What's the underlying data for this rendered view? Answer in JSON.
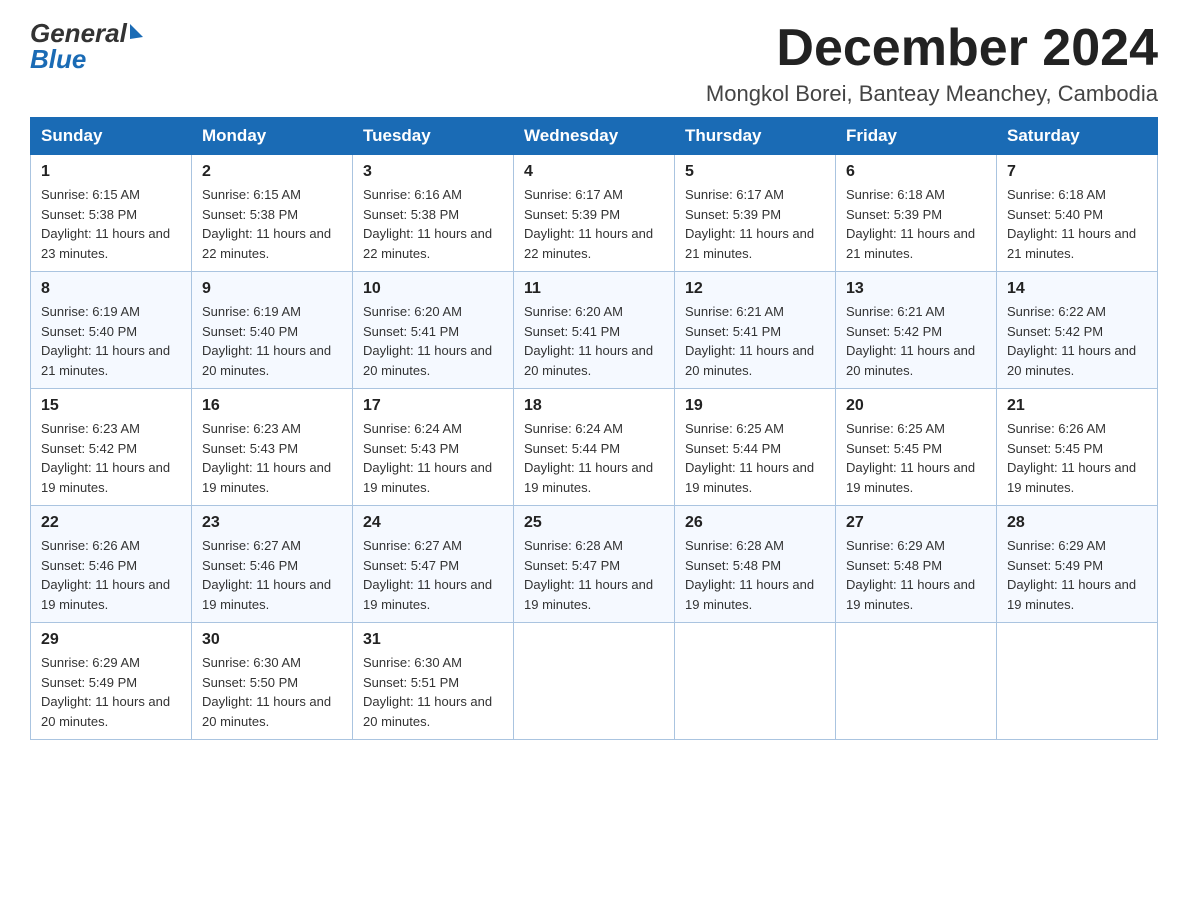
{
  "header": {
    "month_title": "December 2024",
    "location": "Mongkol Borei, Banteay Meanchey, Cambodia",
    "logo_general": "General",
    "logo_blue": "Blue"
  },
  "days_of_week": [
    "Sunday",
    "Monday",
    "Tuesday",
    "Wednesday",
    "Thursday",
    "Friday",
    "Saturday"
  ],
  "weeks": [
    [
      {
        "day": "1",
        "sunrise": "6:15 AM",
        "sunset": "5:38 PM",
        "daylight": "11 hours and 23 minutes."
      },
      {
        "day": "2",
        "sunrise": "6:15 AM",
        "sunset": "5:38 PM",
        "daylight": "11 hours and 22 minutes."
      },
      {
        "day": "3",
        "sunrise": "6:16 AM",
        "sunset": "5:38 PM",
        "daylight": "11 hours and 22 minutes."
      },
      {
        "day": "4",
        "sunrise": "6:17 AM",
        "sunset": "5:39 PM",
        "daylight": "11 hours and 22 minutes."
      },
      {
        "day": "5",
        "sunrise": "6:17 AM",
        "sunset": "5:39 PM",
        "daylight": "11 hours and 21 minutes."
      },
      {
        "day": "6",
        "sunrise": "6:18 AM",
        "sunset": "5:39 PM",
        "daylight": "11 hours and 21 minutes."
      },
      {
        "day": "7",
        "sunrise": "6:18 AM",
        "sunset": "5:40 PM",
        "daylight": "11 hours and 21 minutes."
      }
    ],
    [
      {
        "day": "8",
        "sunrise": "6:19 AM",
        "sunset": "5:40 PM",
        "daylight": "11 hours and 21 minutes."
      },
      {
        "day": "9",
        "sunrise": "6:19 AM",
        "sunset": "5:40 PM",
        "daylight": "11 hours and 20 minutes."
      },
      {
        "day": "10",
        "sunrise": "6:20 AM",
        "sunset": "5:41 PM",
        "daylight": "11 hours and 20 minutes."
      },
      {
        "day": "11",
        "sunrise": "6:20 AM",
        "sunset": "5:41 PM",
        "daylight": "11 hours and 20 minutes."
      },
      {
        "day": "12",
        "sunrise": "6:21 AM",
        "sunset": "5:41 PM",
        "daylight": "11 hours and 20 minutes."
      },
      {
        "day": "13",
        "sunrise": "6:21 AM",
        "sunset": "5:42 PM",
        "daylight": "11 hours and 20 minutes."
      },
      {
        "day": "14",
        "sunrise": "6:22 AM",
        "sunset": "5:42 PM",
        "daylight": "11 hours and 20 minutes."
      }
    ],
    [
      {
        "day": "15",
        "sunrise": "6:23 AM",
        "sunset": "5:42 PM",
        "daylight": "11 hours and 19 minutes."
      },
      {
        "day": "16",
        "sunrise": "6:23 AM",
        "sunset": "5:43 PM",
        "daylight": "11 hours and 19 minutes."
      },
      {
        "day": "17",
        "sunrise": "6:24 AM",
        "sunset": "5:43 PM",
        "daylight": "11 hours and 19 minutes."
      },
      {
        "day": "18",
        "sunrise": "6:24 AM",
        "sunset": "5:44 PM",
        "daylight": "11 hours and 19 minutes."
      },
      {
        "day": "19",
        "sunrise": "6:25 AM",
        "sunset": "5:44 PM",
        "daylight": "11 hours and 19 minutes."
      },
      {
        "day": "20",
        "sunrise": "6:25 AM",
        "sunset": "5:45 PM",
        "daylight": "11 hours and 19 minutes."
      },
      {
        "day": "21",
        "sunrise": "6:26 AM",
        "sunset": "5:45 PM",
        "daylight": "11 hours and 19 minutes."
      }
    ],
    [
      {
        "day": "22",
        "sunrise": "6:26 AM",
        "sunset": "5:46 PM",
        "daylight": "11 hours and 19 minutes."
      },
      {
        "day": "23",
        "sunrise": "6:27 AM",
        "sunset": "5:46 PM",
        "daylight": "11 hours and 19 minutes."
      },
      {
        "day": "24",
        "sunrise": "6:27 AM",
        "sunset": "5:47 PM",
        "daylight": "11 hours and 19 minutes."
      },
      {
        "day": "25",
        "sunrise": "6:28 AM",
        "sunset": "5:47 PM",
        "daylight": "11 hours and 19 minutes."
      },
      {
        "day": "26",
        "sunrise": "6:28 AM",
        "sunset": "5:48 PM",
        "daylight": "11 hours and 19 minutes."
      },
      {
        "day": "27",
        "sunrise": "6:29 AM",
        "sunset": "5:48 PM",
        "daylight": "11 hours and 19 minutes."
      },
      {
        "day": "28",
        "sunrise": "6:29 AM",
        "sunset": "5:49 PM",
        "daylight": "11 hours and 19 minutes."
      }
    ],
    [
      {
        "day": "29",
        "sunrise": "6:29 AM",
        "sunset": "5:49 PM",
        "daylight": "11 hours and 20 minutes."
      },
      {
        "day": "30",
        "sunrise": "6:30 AM",
        "sunset": "5:50 PM",
        "daylight": "11 hours and 20 minutes."
      },
      {
        "day": "31",
        "sunrise": "6:30 AM",
        "sunset": "5:51 PM",
        "daylight": "11 hours and 20 minutes."
      },
      null,
      null,
      null,
      null
    ]
  ],
  "labels": {
    "sunrise": "Sunrise:",
    "sunset": "Sunset:",
    "daylight": "Daylight:"
  }
}
